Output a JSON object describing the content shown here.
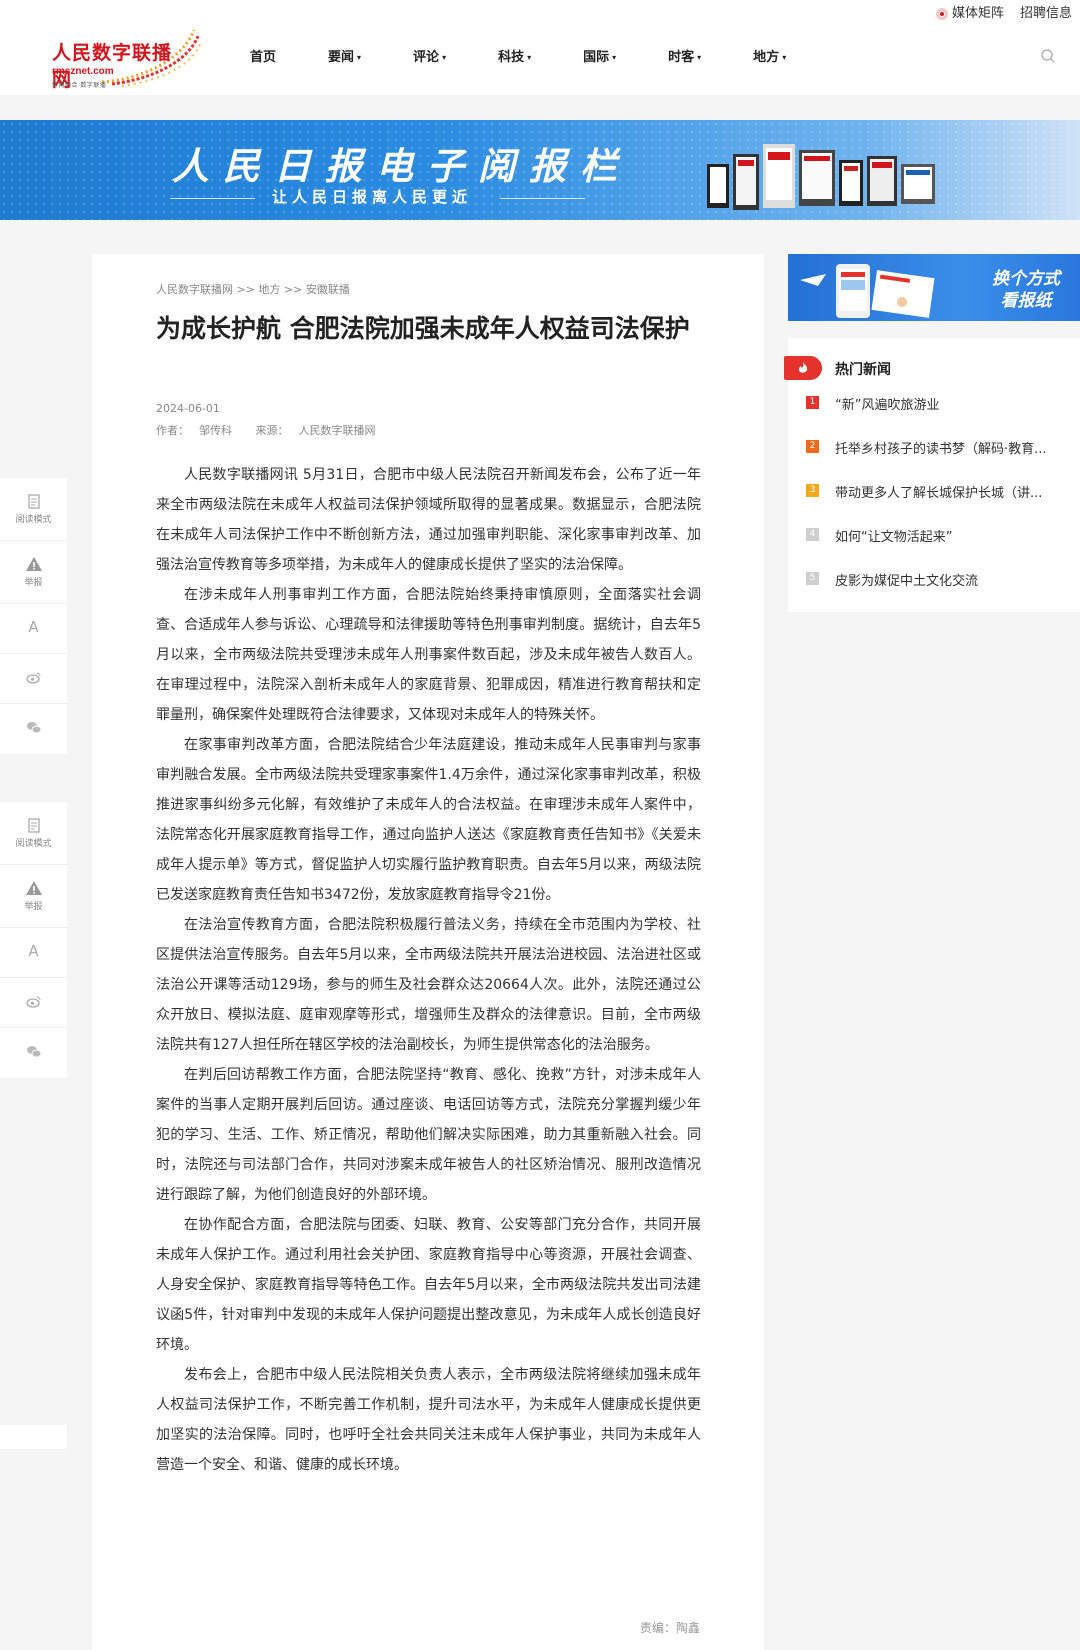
{
  "header": {
    "logo_name": "人民数字联播网",
    "logo_domain": "rmsznet.com",
    "logo_slogan": "新网融合 数字联播",
    "links": [
      "媒体矩阵",
      "招聘信息"
    ],
    "nav": [
      {
        "label": "首页",
        "dropdown": false
      },
      {
        "label": "要闻",
        "dropdown": true
      },
      {
        "label": "评论",
        "dropdown": true
      },
      {
        "label": "科技",
        "dropdown": true
      },
      {
        "label": "国际",
        "dropdown": true
      },
      {
        "label": "时客",
        "dropdown": true
      },
      {
        "label": "地方",
        "dropdown": true
      }
    ],
    "caret": "▾",
    "brand_color": "#d2141c"
  },
  "banner": {
    "title": "人民日报电子阅报栏",
    "subtitle": "让人民日报离人民更近"
  },
  "article": {
    "breadcrumb": "人民数字联播网 >> 地方 >> 安徽联播",
    "title": "为成长护航 合肥法院加强未成年人权益司法保护",
    "date": "2024-06-01",
    "author_label": "作者：",
    "author": "邹传科",
    "source_label": "来源：",
    "source": "人民数字联播网",
    "paragraphs": [
      "人民数字联播网讯 5月31日，合肥市中级人民法院召开新闻发布会，公布了近一年来全市两级法院在未成年人权益司法保护领域所取得的显著成果。数据显示，合肥法院在未成年人司法保护工作中不断创新方法，通过加强审判职能、深化家事审判改革、加强法治宣传教育等多项举措，为未成年人的健康成长提供了坚实的法治保障。",
      "在涉未成年人刑事审判工作方面，合肥法院始终秉持审慎原则，全面落实社会调查、合适成年人参与诉讼、心理疏导和法律援助等特色刑事审判制度。据统计，自去年5月以来，全市两级法院共受理涉未成年人刑事案件数百起，涉及未成年被告人数百人。在审理过程中，法院深入剖析未成年人的家庭背景、犯罪成因，精准进行教育帮扶和定罪量刑，确保案件处理既符合法律要求，又体现对未成年人的特殊关怀。",
      "在家事审判改革方面，合肥法院结合少年法庭建设，推动未成年人民事审判与家事审判融合发展。全市两级法院共受理家事案件1.4万余件，通过深化家事审判改革，积极推进家事纠纷多元化解，有效维护了未成年人的合法权益。在审理涉未成年人案件中，法院常态化开展家庭教育指导工作，通过向监护人送达《家庭教育责任告知书》《关爱未成年人提示单》等方式，督促监护人切实履行监护教育职责。自去年5月以来，两级法院已发送家庭教育责任告知书3472份，发放家庭教育指导令21份。",
      "在法治宣传教育方面，合肥法院积极履行普法义务，持续在全市范围内为学校、社区提供法治宣传服务。自去年5月以来，全市两级法院共开展法治进校园、法治进社区或法治公开课等活动129场，参与的师生及社会群众达20664人次。此外，法院还通过公众开放日、模拟法庭、庭审观摩等形式，增强师生及群众的法律意识。目前，全市两级法院共有127人担任所在辖区学校的法治副校长，为师生提供常态化的法治服务。",
      "在判后回访帮教工作方面，合肥法院坚持“教育、感化、挽救”方针，对涉未成年人案件的当事人定期开展判后回访。通过座谈、电话回访等方式，法院充分掌握判缓少年犯的学习、生活、工作、矫正情况，帮助他们解决实际困难，助力其重新融入社会。同时，法院还与司法部门合作，共同对涉案未成年被告人的社区矫治情况、服刑改造情况进行跟踪了解，为他们创造良好的外部环境。",
      "在协作配合方面，合肥法院与团委、妇联、教育、公安等部门充分合作，共同开展未成年人保护工作。通过利用社会关护团、家庭教育指导中心等资源，开展社会调查、人身安全保护、家庭教育指导等特色工作。自去年5月以来，全市两级法院共发出司法建议函5件，针对审判中发现的未成年人保护问题提出整改意见，为未成年人成长创造良好环境。",
      "发布会上，合肥市中级人民法院相关负责人表示，全市两级法院将继续加强未成年人权益司法保护工作，不断完善工作机制，提升司法水平，为未成年人健康成长提供更加坚实的法治保障。同时，也呼吁全社会共同关注未成年人保护事业，共同为未成年人营造一个安全、和谐、健康的成长环境。"
    ],
    "editor_label": "责编：",
    "editor": "陶鑫"
  },
  "tools": [
    {
      "icon": "book-icon",
      "label": "阅读模式"
    },
    {
      "icon": "warning-icon",
      "label": "举报"
    },
    {
      "icon": "font-size-icon",
      "glyph": "A"
    },
    {
      "icon": "weibo-icon"
    },
    {
      "icon": "wechat-icon"
    }
  ],
  "ad": {
    "line1": "换个方式",
    "line2": "看报纸"
  },
  "hot_news": {
    "title": "热门新闻",
    "items": [
      {
        "rank": "1",
        "text": "“新”风遍吹旅游业",
        "color": "#e5322d"
      },
      {
        "rank": "2",
        "text": "托举乡村孩子的读书梦（解码·教育...",
        "color": "#f06a1e"
      },
      {
        "rank": "3",
        "text": "带动更多人了解长城保护长城（讲...",
        "color": "#f4a81c"
      },
      {
        "rank": "4",
        "text": "如何“让文物活起来”",
        "color": "#cfcfcf"
      },
      {
        "rank": "5",
        "text": "皮影为媒促中土文化交流",
        "color": "#cfcfcf"
      }
    ]
  }
}
